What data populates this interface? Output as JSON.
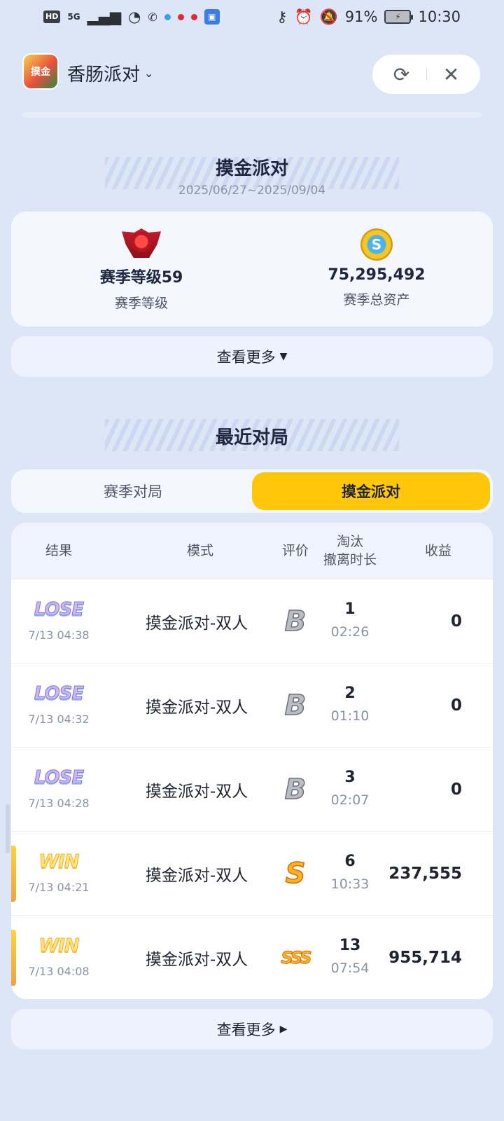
{
  "status_bar": {
    "left_icons": [
      "HD",
      "5G"
    ],
    "battery": "91%",
    "time": "10:30"
  },
  "header": {
    "app_icon_text": "摸金",
    "app_name": "香肠派对"
  },
  "season": {
    "title": "摸金派对",
    "dates": "2025/06/27~2025/09/04",
    "stats": [
      {
        "value": "赛季等级59",
        "label": "赛季等级",
        "icon": "rank-gem-icon"
      },
      {
        "value": "75,295,492",
        "label": "赛季总资产",
        "icon": "coin-icon"
      }
    ],
    "more_label": "查看更多"
  },
  "recent": {
    "title": "最近对局",
    "tabs": [
      {
        "label": "赛季对局",
        "active": false
      },
      {
        "label": "摸金派对",
        "active": true
      }
    ],
    "headers": {
      "result": "结果",
      "mode": "模式",
      "rating": "评价",
      "kills": "淘汰",
      "duration": "撤离时长",
      "income": "收益"
    },
    "rows": [
      {
        "result": "LOSE",
        "time": "7/13 04:38",
        "mode": "摸金派对-双人",
        "rating": "B",
        "kills": "1",
        "duration": "02:26",
        "income": "0"
      },
      {
        "result": "LOSE",
        "time": "7/13 04:32",
        "mode": "摸金派对-双人",
        "rating": "B",
        "kills": "2",
        "duration": "01:10",
        "income": "0"
      },
      {
        "result": "LOSE",
        "time": "7/13 04:28",
        "mode": "摸金派对-双人",
        "rating": "B",
        "kills": "3",
        "duration": "02:07",
        "income": "0"
      },
      {
        "result": "WIN",
        "time": "7/13 04:21",
        "mode": "摸金派对-双人",
        "rating": "S",
        "kills": "6",
        "duration": "10:33",
        "income": "237,555"
      },
      {
        "result": "WIN",
        "time": "7/13 04:08",
        "mode": "摸金派对-双人",
        "rating": "SSS",
        "kills": "13",
        "duration": "07:54",
        "income": "955,714"
      }
    ],
    "more_label": "查看更多"
  },
  "colors": {
    "background": "#dce6f7",
    "active_tab": "#ffc60a",
    "card": "#f4f8fe"
  }
}
